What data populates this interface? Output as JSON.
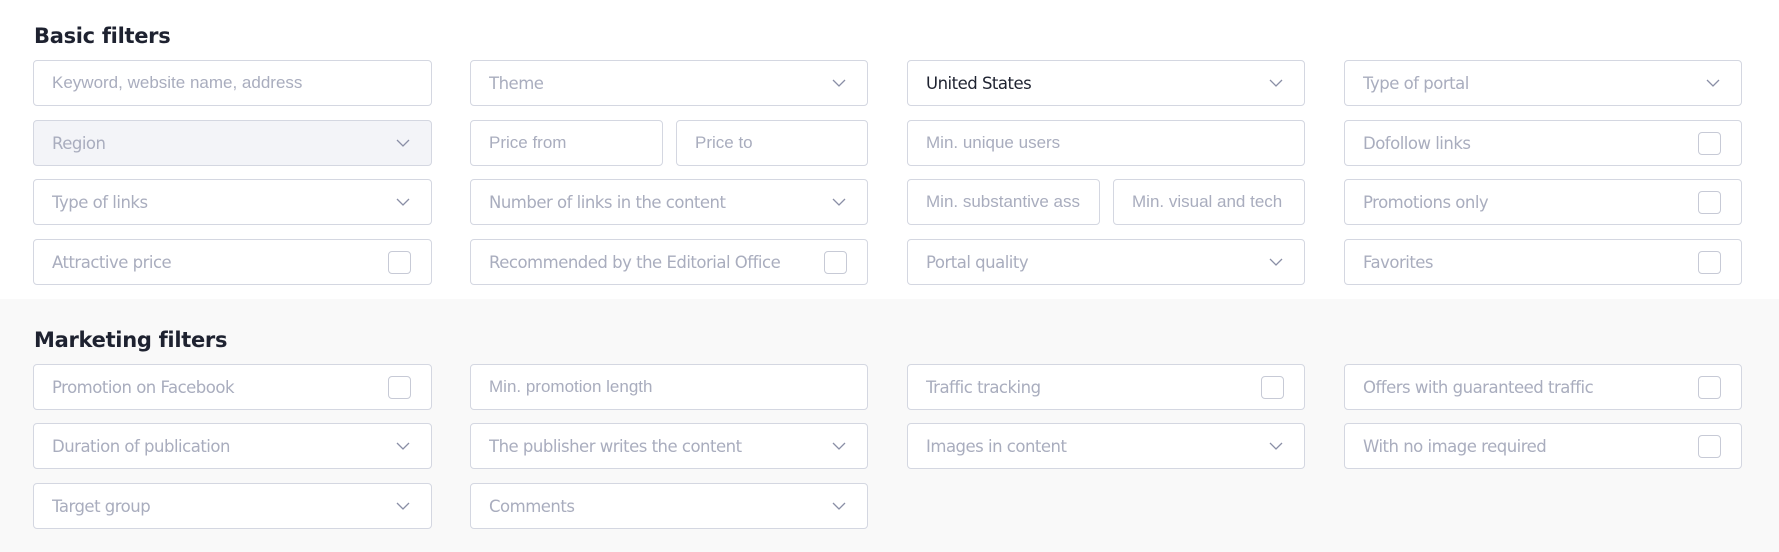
{
  "basic": {
    "title": "Basic filters",
    "keyword": {
      "placeholder": "Keyword, website name, address"
    },
    "theme": {
      "label": "Theme"
    },
    "country": {
      "value": "United States"
    },
    "portal_type": {
      "label": "Type of portal"
    },
    "region": {
      "label": "Region"
    },
    "price_from": {
      "placeholder": "Price from"
    },
    "price_to": {
      "placeholder": "Price to"
    },
    "min_unique_users": {
      "placeholder": "Min. unique users"
    },
    "dofollow": {
      "label": "Dofollow links",
      "checked": false
    },
    "link_type": {
      "label": "Type of links"
    },
    "links_count": {
      "label": "Number of links in the content"
    },
    "min_substantive": {
      "placeholder": "Min. substantive ass"
    },
    "min_visual": {
      "placeholder": "Min. visual and tech"
    },
    "promotions_only": {
      "label": "Promotions only",
      "checked": false
    },
    "attractive_price": {
      "label": "Attractive price",
      "checked": false
    },
    "recommended": {
      "label": "Recommended by the Editorial Office",
      "checked": false
    },
    "portal_quality": {
      "label": "Portal quality"
    },
    "favorites": {
      "label": "Favorites",
      "checked": false
    }
  },
  "marketing": {
    "title": "Marketing filters",
    "facebook": {
      "label": "Promotion on Facebook",
      "checked": false
    },
    "min_promotion_length": {
      "placeholder": "Min. promotion length"
    },
    "traffic_tracking": {
      "label": "Traffic tracking",
      "checked": false
    },
    "guaranteed_traffic": {
      "label": "Offers with guaranteed traffic",
      "checked": false
    },
    "duration": {
      "label": "Duration of publication"
    },
    "publisher_writes": {
      "label": "The publisher writes the content"
    },
    "images": {
      "label": "Images in content"
    },
    "no_image": {
      "label": "With no image required",
      "checked": false
    },
    "target_group": {
      "label": "Target group"
    },
    "comments": {
      "label": "Comments"
    }
  },
  "colors": {
    "border": "#d4d7e1",
    "placeholder": "#a9adbe",
    "text": "#1e2230",
    "disabled_bg": "#f3f4f8",
    "marketing_bg": "#f9f9f9"
  }
}
